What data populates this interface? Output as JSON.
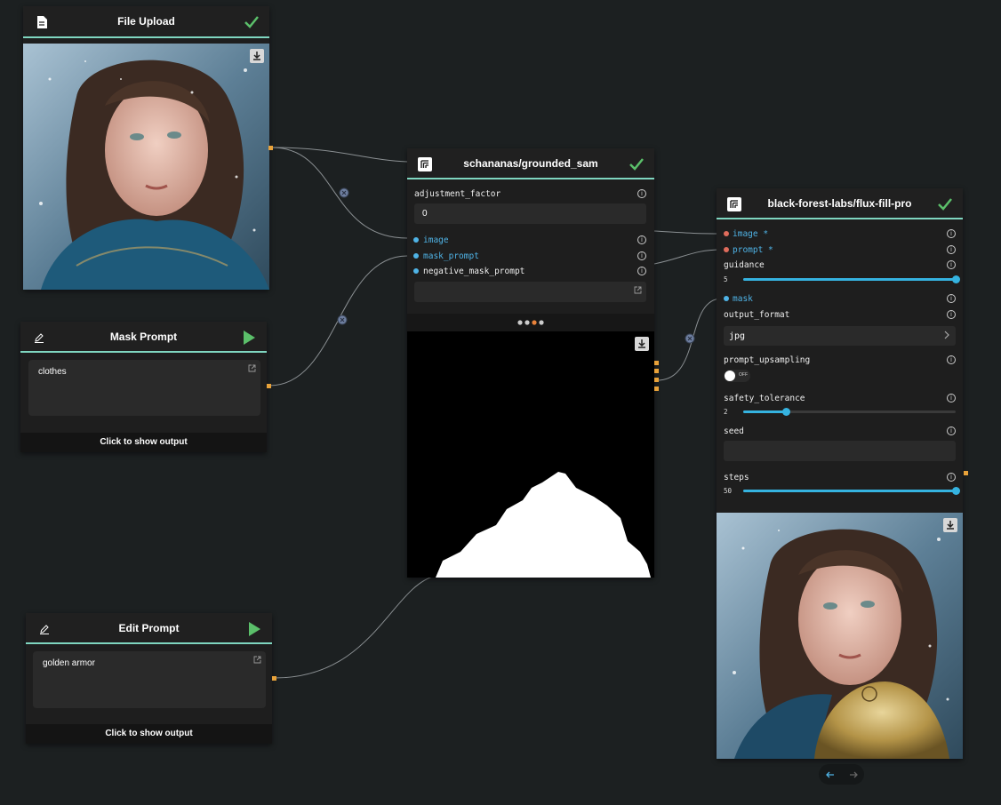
{
  "nodes": {
    "file_upload": {
      "title": "File Upload",
      "icon": "document-icon",
      "status": "check-icon"
    },
    "mask_prompt": {
      "title": "Mask Prompt",
      "icon": "pencil-icon",
      "run": "play-icon",
      "text": "clothes",
      "footer": "Click to show output"
    },
    "edit_prompt": {
      "title": "Edit Prompt",
      "icon": "pencil-icon",
      "run": "play-icon",
      "text": "golden armor",
      "footer": "Click to show output"
    },
    "grounded_sam": {
      "title": "schananas/grounded_sam",
      "adjustment_factor_label": "adjustment_factor",
      "adjustment_factor_value": "0",
      "inputs": [
        "image",
        "mask_prompt",
        "negative_mask_prompt"
      ],
      "negative_mask_prompt_value": ""
    },
    "flux_fill": {
      "title": "black-forest-labs/flux-fill-pro",
      "image_label": "image *",
      "prompt_label": "prompt *",
      "guidance_label": "guidance",
      "guidance_value": "5",
      "guidance_fraction": 1.0,
      "mask_label": "mask",
      "output_format_label": "output_format",
      "output_format_value": "jpg",
      "prompt_upsampling_label": "prompt_upsampling",
      "toggle_text": "OFF",
      "safety_tolerance_label": "safety_tolerance",
      "safety_tolerance_value": "2",
      "safety_tolerance_fraction": 0.2,
      "seed_label": "seed",
      "seed_value": "",
      "steps_label": "steps",
      "steps_value": "50",
      "steps_fraction": 1.0
    }
  },
  "colors": {
    "background": "#1c2021",
    "header_accent": "#7fd6c0",
    "port": "#e8a23a",
    "input_dot": "#4fb3e6",
    "required_dot": "#e06c5c",
    "slider": "#35b3e0",
    "check": "#5bbf6a"
  }
}
